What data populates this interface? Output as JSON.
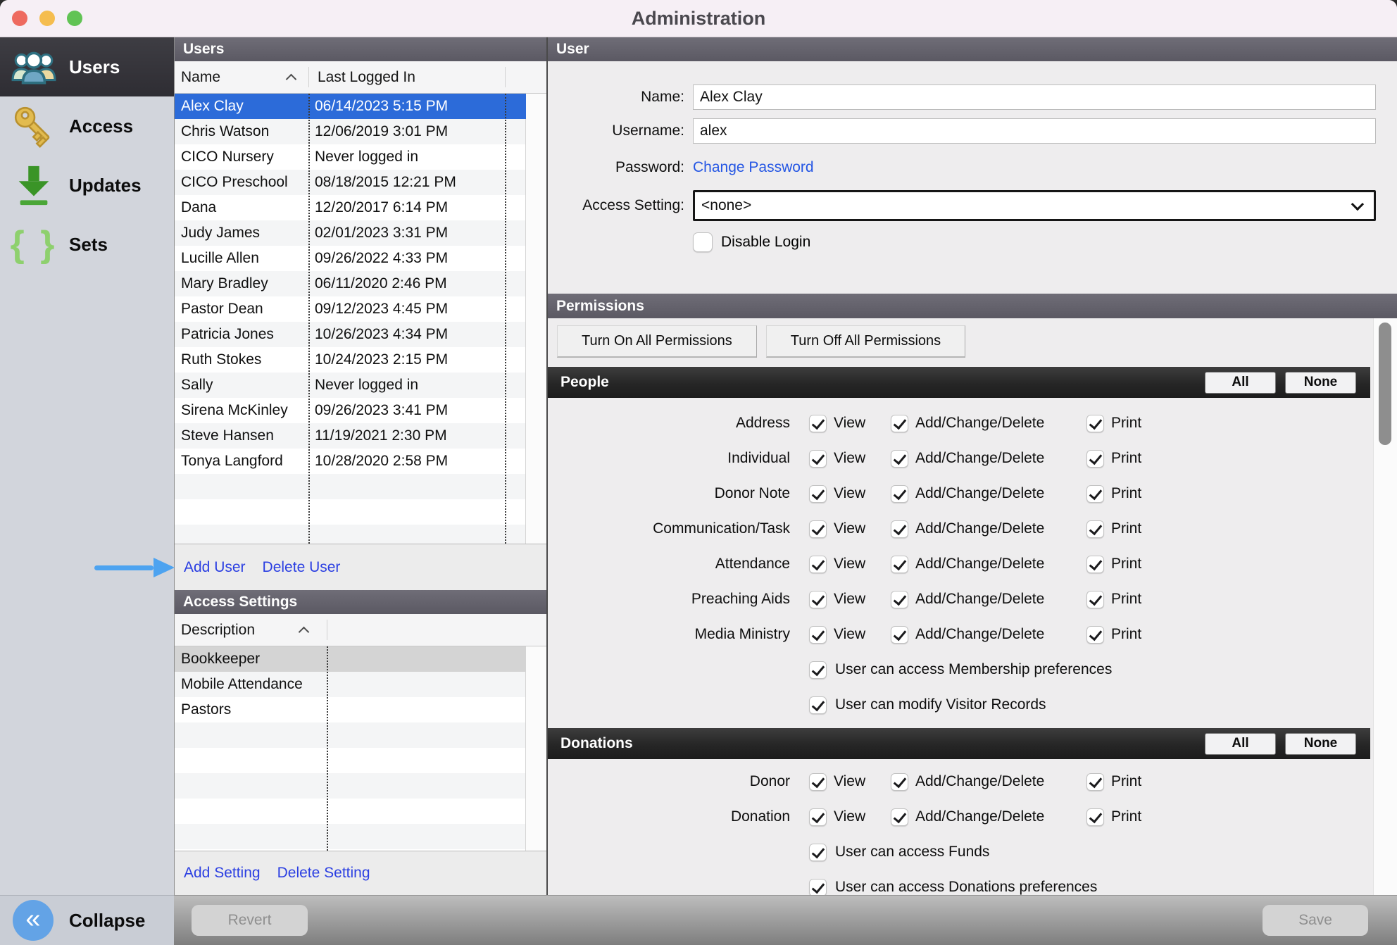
{
  "window": {
    "title": "Administration"
  },
  "sidebar": {
    "items": [
      {
        "label": "Users",
        "icon": "users-icon",
        "selected": true
      },
      {
        "label": "Access",
        "icon": "key-icon",
        "selected": false
      },
      {
        "label": "Updates",
        "icon": "download-icon",
        "selected": false
      },
      {
        "label": "Sets",
        "icon": "braces-icon",
        "selected": false
      }
    ],
    "collapse_label": "Collapse"
  },
  "users_panel": {
    "header": "Users",
    "columns": {
      "name": "Name",
      "last_logged_in": "Last Logged In"
    },
    "rows": [
      {
        "name": "Alex Clay",
        "last_logged_in": "06/14/2023 5:15 PM",
        "selected": true
      },
      {
        "name": "Chris Watson",
        "last_logged_in": "12/06/2019 3:01 PM"
      },
      {
        "name": "CICO Nursery",
        "last_logged_in": "Never logged in"
      },
      {
        "name": "CICO Preschool",
        "last_logged_in": "08/18/2015 12:21 PM"
      },
      {
        "name": "Dana",
        "last_logged_in": "12/20/2017 6:14 PM"
      },
      {
        "name": "Judy James",
        "last_logged_in": "02/01/2023 3:31 PM"
      },
      {
        "name": "Lucille Allen",
        "last_logged_in": "09/26/2022 4:33 PM"
      },
      {
        "name": "Mary Bradley",
        "last_logged_in": "06/11/2020 2:46 PM"
      },
      {
        "name": "Pastor Dean",
        "last_logged_in": "09/12/2023 4:45 PM"
      },
      {
        "name": "Patricia Jones",
        "last_logged_in": "10/26/2023 4:34 PM"
      },
      {
        "name": "Ruth Stokes",
        "last_logged_in": "10/24/2023 2:15 PM"
      },
      {
        "name": "Sally",
        "last_logged_in": "Never logged in"
      },
      {
        "name": "Sirena McKinley",
        "last_logged_in": "09/26/2023 3:41 PM"
      },
      {
        "name": "Steve Hansen",
        "last_logged_in": "11/19/2021 2:30 PM"
      },
      {
        "name": "Tonya Langford",
        "last_logged_in": "10/28/2020 2:58 PM"
      }
    ],
    "add_link": "Add User",
    "delete_link": "Delete User"
  },
  "access_settings_panel": {
    "header": "Access Settings",
    "columns": {
      "description": "Description"
    },
    "rows": [
      {
        "description": "Bookkeeper",
        "selected": true
      },
      {
        "description": "Mobile Attendance"
      },
      {
        "description": "Pastors"
      }
    ],
    "add_link": "Add Setting",
    "delete_link": "Delete Setting"
  },
  "user_panel": {
    "header": "User",
    "fields": {
      "name_label": "Name:",
      "name_value": "Alex Clay",
      "username_label": "Username:",
      "username_value": "alex",
      "password_label": "Password:",
      "password_link": "Change Password",
      "access_setting_label": "Access Setting:",
      "access_setting_value": "<none>",
      "disable_login_label": "Disable Login",
      "disable_login_checked": false
    }
  },
  "permissions_panel": {
    "header": "Permissions",
    "turn_on_button": "Turn On All Permissions",
    "turn_off_button": "Turn Off All Permissions",
    "labels": {
      "view": "View",
      "acd": "Add/Change/Delete",
      "print": "Print"
    },
    "sections": [
      {
        "title": "People",
        "all_label": "All",
        "none_label": "None",
        "rows": [
          {
            "label": "Address",
            "view": true,
            "acd": true,
            "print": true
          },
          {
            "label": "Individual",
            "view": true,
            "acd": true,
            "print": true
          },
          {
            "label": "Donor Note",
            "view": true,
            "acd": true,
            "print": true
          },
          {
            "label": "Communication/Task",
            "view": true,
            "acd": true,
            "print": true
          },
          {
            "label": "Attendance",
            "view": true,
            "acd": true,
            "print": true
          },
          {
            "label": "Preaching Aids",
            "view": true,
            "acd": true,
            "print": true
          },
          {
            "label": "Media Ministry",
            "view": true,
            "acd": true,
            "print": true
          }
        ],
        "extras": [
          {
            "label": "User can access Membership preferences",
            "checked": true
          },
          {
            "label": "User can modify Visitor Records",
            "checked": true
          }
        ]
      },
      {
        "title": "Donations",
        "all_label": "All",
        "none_label": "None",
        "rows": [
          {
            "label": "Donor",
            "view": true,
            "acd": true,
            "print": true
          },
          {
            "label": "Donation",
            "view": true,
            "acd": true,
            "print": true
          }
        ],
        "extras": [
          {
            "label": "User can access Funds",
            "checked": true
          },
          {
            "label": "User can access Donations preferences",
            "checked": true
          }
        ]
      }
    ]
  },
  "footer": {
    "revert_button": "Revert",
    "save_button": "Save"
  },
  "colors": {
    "selection_blue": "#2c6bd9",
    "link_blue": "#2b3fe2",
    "arrow_blue": "#4da3f0",
    "header_purple": "#615f69",
    "section_black": "#262626",
    "key_gold": "#e2bb4f",
    "update_green": "#3a9427",
    "braces_green": "#8ed06e",
    "collapse_blue": "#63a3e6"
  }
}
